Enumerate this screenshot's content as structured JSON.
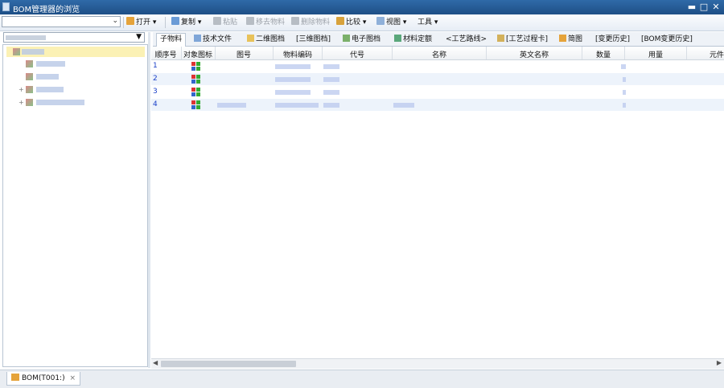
{
  "window": {
    "title": "BOM管理器的浏览"
  },
  "toolbar": {
    "items": [
      {
        "label": "打开",
        "icon": "open-folder-icon",
        "enabled": true
      },
      {
        "label": "复制",
        "icon": "copy-icon",
        "enabled": true
      },
      {
        "label": "粘贴",
        "icon": "paste-icon",
        "enabled": false
      },
      {
        "label": "移去物料",
        "icon": "remove-material-icon",
        "enabled": false
      },
      {
        "label": "删除物料",
        "icon": "delete-material-icon",
        "enabled": false
      },
      {
        "label": "比较",
        "icon": "compare-icon",
        "enabled": true
      },
      {
        "label": "视图",
        "icon": "view-icon",
        "enabled": true
      },
      {
        "label": "工具",
        "icon": "",
        "enabled": true
      }
    ]
  },
  "tabs": [
    {
      "label": "子物料",
      "icon": ""
    },
    {
      "label": "技术文件",
      "icon": "document-icon"
    },
    {
      "label": "二维图档",
      "icon": "drawing-2d-icon"
    },
    {
      "label": "[三维图档]",
      "icon": ""
    },
    {
      "label": "电子图档",
      "icon": "electronic-drawing-icon"
    },
    {
      "label": "材料定额",
      "icon": "material-quota-icon"
    },
    {
      "label": "<工艺路线>",
      "icon": ""
    },
    {
      "label": "[工艺过程卡]",
      "icon": "process-card-icon"
    },
    {
      "label": "简图",
      "icon": "sketch-icon"
    },
    {
      "label": "[变更历史]",
      "icon": ""
    },
    {
      "label": "[BOM变更历史]",
      "icon": ""
    }
  ],
  "grid": {
    "columns": [
      "顺序号",
      "对象图标",
      "图号",
      "物料编码",
      "代号",
      "名称",
      "英文名称",
      "数量",
      "用量",
      "元件"
    ],
    "rows": [
      {
        "seq": "1"
      },
      {
        "seq": "2"
      },
      {
        "seq": "3"
      },
      {
        "seq": "4"
      }
    ]
  },
  "statusbar": {
    "doc_tab": "BOM(T001:)"
  },
  "colors": {
    "titlebar": "#1e4f86",
    "selected_tree": "#fbf1b5",
    "seq_text": "#1a3fc8",
    "alt_row": "#edf3fb"
  }
}
